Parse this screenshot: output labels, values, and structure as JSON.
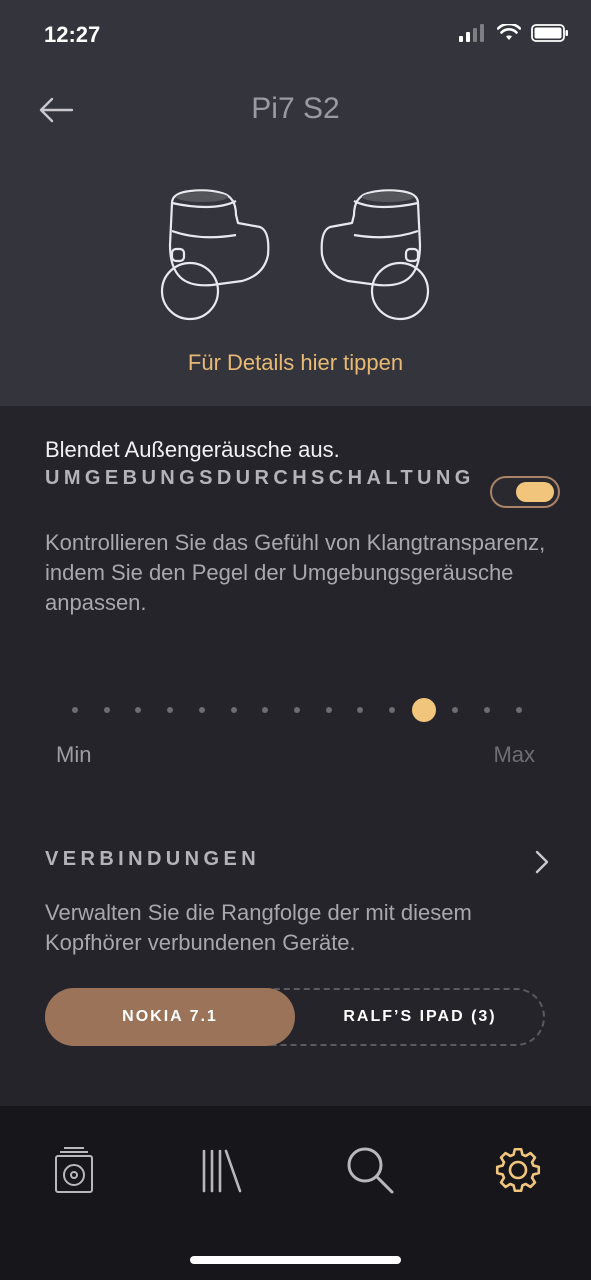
{
  "status_bar": {
    "time": "12:27"
  },
  "header": {
    "title": "Pi7 S2",
    "details_link": "Für Details hier tippen"
  },
  "anc": {
    "subtitle": "Blendet Außengeräusche aus.",
    "heading": "UMGEBUNGSDURCHSCHALTUNG",
    "enabled": true,
    "description": "Kontrollieren Sie das Gefühl von Klangtransparenz, indem Sie den Pegel der Umgebungsgeräusche anpassen.",
    "level": {
      "min_label": "Min",
      "max_label": "Max",
      "steps": 15,
      "selected_index": 11
    }
  },
  "connections": {
    "heading": "VERBINDUNGEN",
    "description": "Verwalten Sie die Rangfolge der mit diesem Kopfhörer verbundenen Geräte.",
    "devices": [
      {
        "label": "NOKIA 7.1",
        "active": true
      },
      {
        "label": "RALF’S IPAD (3)",
        "active": false
      }
    ]
  },
  "bottom_nav": [
    {
      "icon": "speaker-icon",
      "active": false
    },
    {
      "icon": "library-icon",
      "active": false
    },
    {
      "icon": "search-icon",
      "active": false
    },
    {
      "icon": "gear-icon",
      "active": true
    }
  ],
  "colors": {
    "accent": "#f1c57c",
    "accent_brown": "#9a7359",
    "background": "#25242b",
    "header_bg": "#34353c"
  }
}
